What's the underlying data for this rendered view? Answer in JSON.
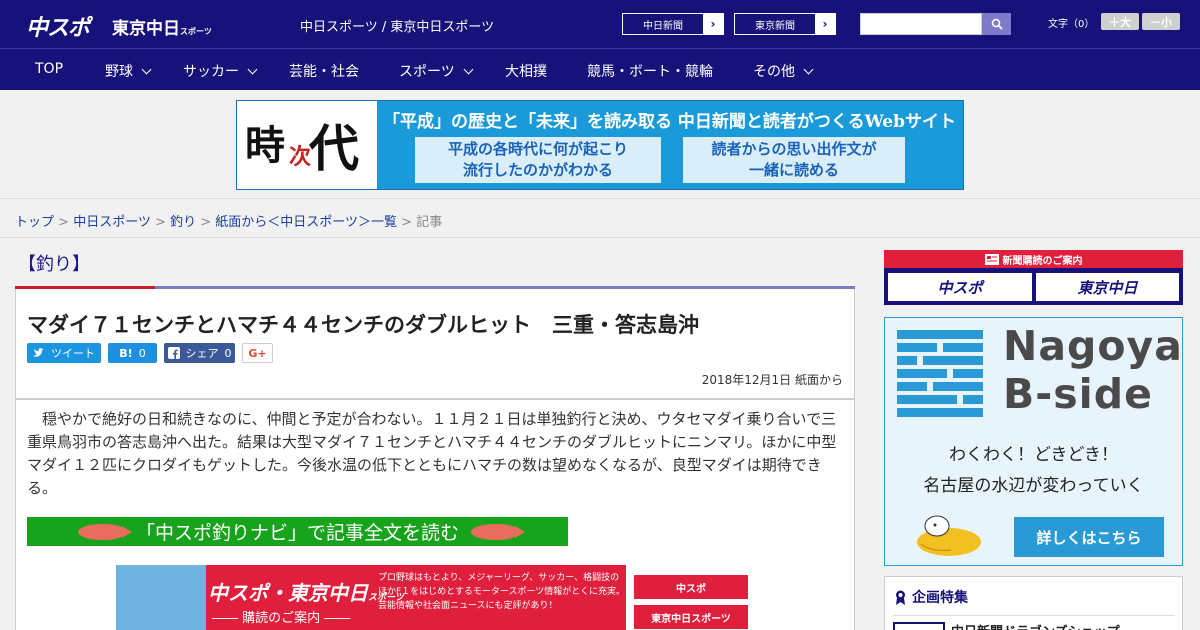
{
  "header": {
    "logo_chuspo": "中スポ",
    "logo_tokyo": "東京中日",
    "logo_tokyo_small": "スポーツ",
    "site_name": "中日スポーツ / 東京中日スポーツ",
    "link_chunichi": "中日新聞",
    "link_tokyo": "東京新聞",
    "arrow": "›",
    "search_placeholder": "",
    "font_label": "文字（0）",
    "font_up": "＋大",
    "font_down": "－小"
  },
  "nav": [
    {
      "label": "TOP"
    },
    {
      "label": "野球"
    },
    {
      "label": "サッカー"
    },
    {
      "label": "芸能・社会"
    },
    {
      "label": "スポーツ"
    },
    {
      "label": "大相撲"
    },
    {
      "label": "競馬・ボート・競輪"
    },
    {
      "label": "その他"
    }
  ],
  "banner": {
    "k1": "時",
    "k2": "次",
    "k3": "代",
    "headline": "「平成」の歴史と「未来」を読み取る 中日新聞と読者がつくるWebサイト",
    "box1_line1": "平成の各時代に何が起こり",
    "box1_line2": "流行したのかがわかる",
    "box2_line1": "読者からの思い出作文が",
    "box2_line2": "一緒に読める"
  },
  "breadcrumb": {
    "top": "トップ",
    "chuspo": "中日スポーツ",
    "fishing": "釣り",
    "paper": "紙面から＜中日スポーツ＞一覧",
    "sep": " > ",
    "current": "記事"
  },
  "category": "【釣り】",
  "article": {
    "title": "マダイ７１センチとハマチ４４センチのダブルヒット　三重・答志島沖",
    "tweet": "ツイート",
    "hatena_mark": "B!",
    "hatena_count": "0",
    "fb_label": "シェア",
    "fb_count": "0",
    "gplus": "G+",
    "date": "2018年12月1日 紙面から",
    "body": "穏やかで絶好の日和続きなのに、仲間と予定が合わない。１１月２１日は単独釣行と決め、ウタセマダイ乗り合いで三重県鳥羽市の答志島沖へ出た。結果は大型マダイ７１センチとハマチ４４センチのダブルヒットにニンマリ。ほかに中型マダイ１２匹にクロダイもゲットした。今後水温の低下とともにハマチの数は望めなくなるが、良型マダイは期待できる。",
    "navi_link": "「中スポ釣りナビ」で記事全文を読む"
  },
  "subscribe_banner": {
    "head": "中スポ・東京中日",
    "head_small": "スポーツ",
    "sub": "―― 購読のご案内 ――",
    "text": "プロ野球はもとより、メジャーリーグ、サッカー、格闘技のほかF１をはじめとするモータースポーツ情報がとくに充実。芸能情報や社会面ニュースにも定評があり！",
    "btn1": "中スポ",
    "btn2": "東京中日スポーツ"
  },
  "sidebar": {
    "subscribe_title": "新聞購読のご案内",
    "sub_btn1": "中スポ",
    "sub_btn2": "東京中日",
    "bside_line1": "Nagoya",
    "bside_line2": "B-side",
    "bside_text1": "わくわく！どきどき！",
    "bside_text2": "名古屋の水辺が変わっていく",
    "bside_button": "詳しくはこちら",
    "feature_title": "企画特集",
    "feature_item": "中日新聞ドラゴンズショップ"
  },
  "colors": {
    "navy": "#17127a",
    "accent_purple": "#7f79c9",
    "red": "#c81e2a",
    "green": "#18a31c",
    "sky": "#2a9ad6"
  }
}
